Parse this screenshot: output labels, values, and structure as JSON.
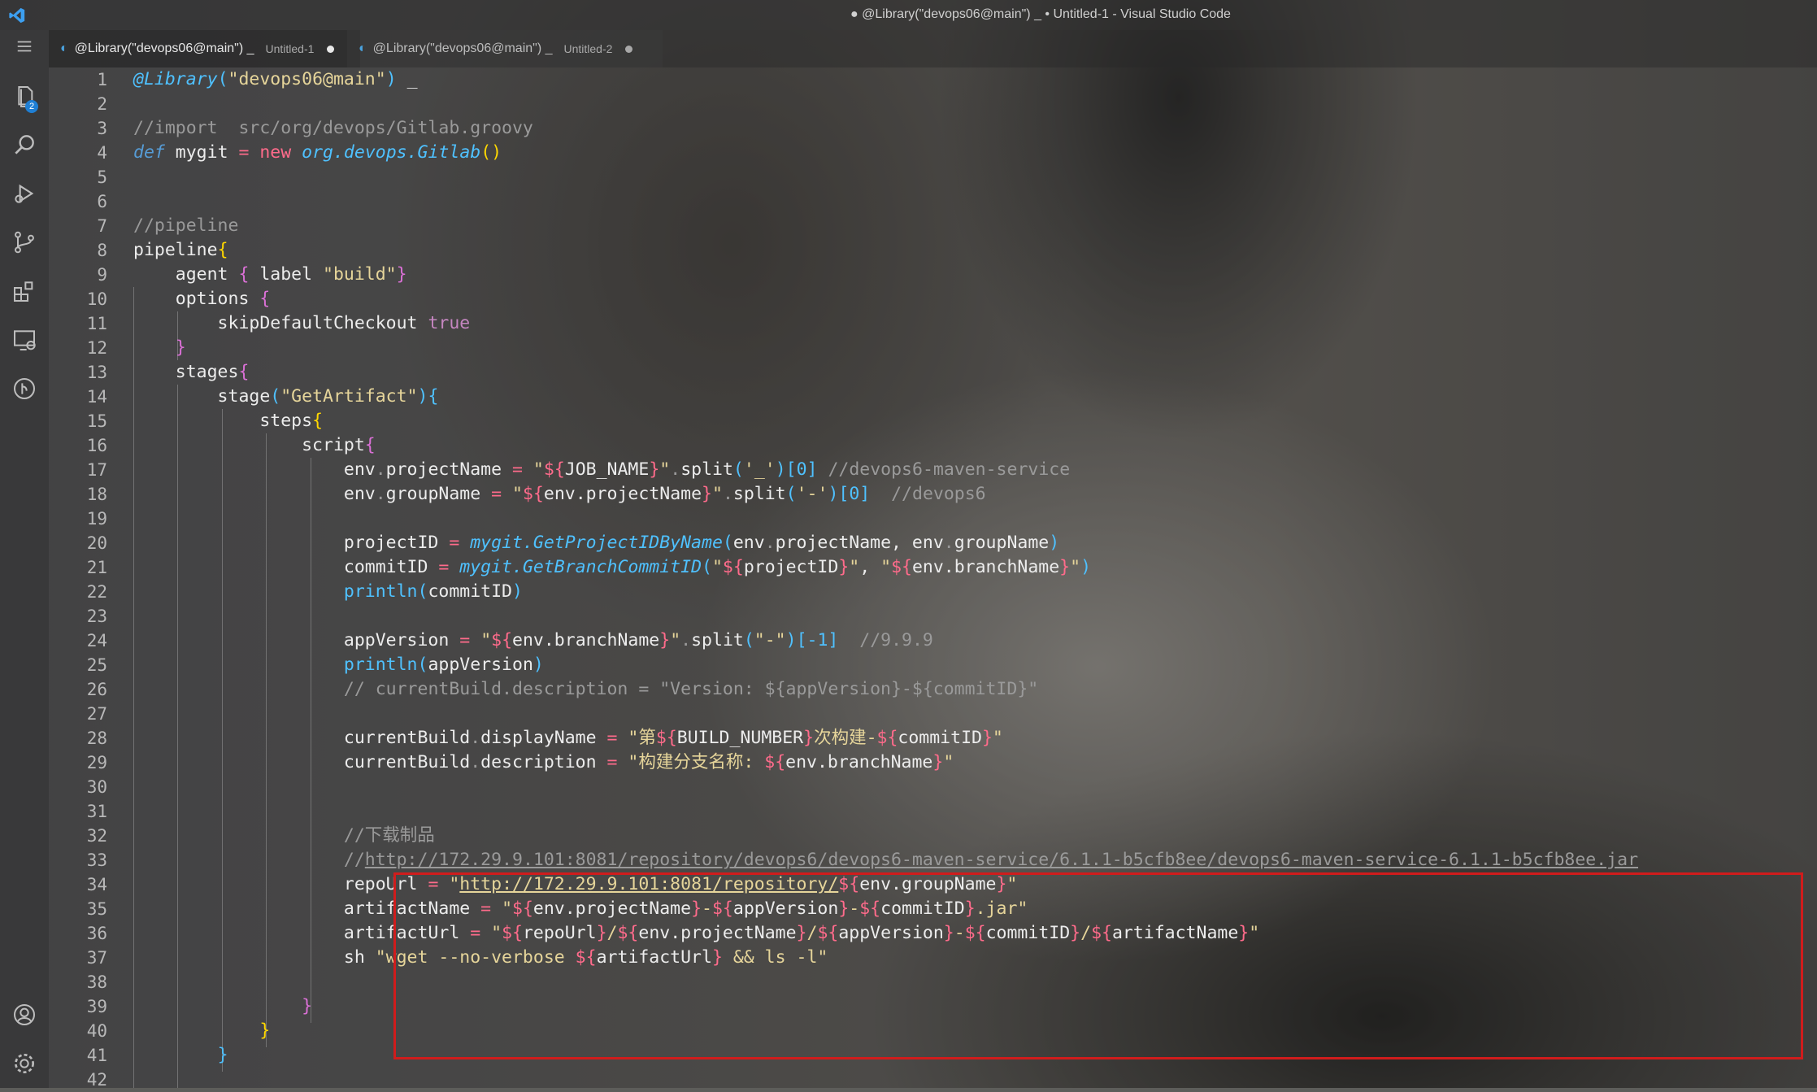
{
  "window": {
    "title": "● @Library(\"devops06@main\") _ • Untitled-1 - Visual Studio Code"
  },
  "activity_bar": {
    "explorer_badge": "2",
    "items": [
      "files-icon",
      "search-icon",
      "run-debug-icon",
      "source-control-icon",
      "extensions-icon",
      "remote-explorer-icon",
      "gitlens-icon"
    ],
    "bottom": [
      "account-icon",
      "settings-gear-icon"
    ]
  },
  "tabs": [
    {
      "label": "@Library(\"devops06@main\") _",
      "sub": "Untitled-1",
      "active": true,
      "modified": true
    },
    {
      "label": "@Library(\"devops06@main\") _",
      "sub": "Untitled-2",
      "active": false,
      "modified": true
    }
  ],
  "editor": {
    "line_numbers": [
      "1",
      "2",
      "3",
      "4",
      "5",
      "6",
      "7",
      "8",
      "9",
      "10",
      "11",
      "12",
      "13",
      "14",
      "15",
      "16",
      "17",
      "18",
      "19",
      "20",
      "21",
      "22",
      "23",
      "24",
      "25",
      "26",
      "27",
      "28",
      "29",
      "30",
      "31",
      "32",
      "33",
      "34",
      "35",
      "36",
      "37",
      "38",
      "39",
      "40",
      "41",
      "42"
    ],
    "lines": [
      [
        [
          "dec",
          "@Library"
        ],
        [
          "pun2",
          "("
        ],
        [
          "str",
          "\"devops06@main\""
        ],
        [
          "pun2",
          ")"
        ],
        [
          "plain",
          " _"
        ]
      ],
      [],
      [
        [
          "cmt",
          "//import  src/org/devops/Gitlab.groovy"
        ]
      ],
      [
        [
          "kw",
          "def"
        ],
        [
          "plain",
          " mygit "
        ],
        [
          "new",
          "="
        ],
        [
          "plain",
          " "
        ],
        [
          "new",
          "new"
        ],
        [
          "plain",
          " "
        ],
        [
          "fn",
          "org.devops.Gitlab"
        ],
        [
          "yel",
          "()"
        ]
      ],
      [],
      [],
      [
        [
          "cmt",
          "//pipeline"
        ]
      ],
      [
        [
          "plain",
          "pipeline"
        ],
        [
          "yel",
          "{"
        ]
      ],
      [
        [
          "plain",
          "    agent "
        ],
        [
          "pun",
          "{"
        ],
        [
          "plain",
          " label "
        ],
        [
          "str",
          "\"build\""
        ],
        [
          "pun",
          "}"
        ]
      ],
      [
        [
          "plain",
          "    options "
        ],
        [
          "pun",
          "{"
        ]
      ],
      [
        [
          "plain",
          "        skipDefaultCheckout "
        ],
        [
          "bool",
          "true"
        ]
      ],
      [
        [
          "plain",
          "    "
        ],
        [
          "pun",
          "}"
        ]
      ],
      [
        [
          "plain",
          "    stages"
        ],
        [
          "pun",
          "{"
        ]
      ],
      [
        [
          "plain",
          "        stage"
        ],
        [
          "pun2",
          "("
        ],
        [
          "str",
          "\"GetArtifact\""
        ],
        [
          "pun2",
          ")"
        ],
        [
          "pun2",
          "{"
        ]
      ],
      [
        [
          "plain",
          "            steps"
        ],
        [
          "yel",
          "{"
        ]
      ],
      [
        [
          "plain",
          "                script"
        ],
        [
          "pun",
          "{"
        ]
      ],
      [
        [
          "plain",
          "                    env"
        ],
        [
          "cmt",
          "."
        ],
        [
          "plain",
          "projectName "
        ],
        [
          "new",
          "="
        ],
        [
          "plain",
          " "
        ],
        [
          "str",
          "\""
        ],
        [
          "tpl",
          "${"
        ],
        [
          "plain",
          "JOB_NAME"
        ],
        [
          "tpl",
          "}"
        ],
        [
          "str",
          "\""
        ],
        [
          "cmt",
          "."
        ],
        [
          "plain",
          "split"
        ],
        [
          "pun2",
          "("
        ],
        [
          "str",
          "'_'"
        ],
        [
          "pun2",
          ")[0]"
        ],
        [
          "plain",
          " "
        ],
        [
          "cmt",
          "//devops6-maven-service"
        ]
      ],
      [
        [
          "plain",
          "                    env"
        ],
        [
          "cmt",
          "."
        ],
        [
          "plain",
          "groupName "
        ],
        [
          "new",
          "="
        ],
        [
          "plain",
          " "
        ],
        [
          "str",
          "\""
        ],
        [
          "tpl",
          "${"
        ],
        [
          "plain",
          "env.projectName"
        ],
        [
          "tpl",
          "}"
        ],
        [
          "str",
          "\""
        ],
        [
          "cmt",
          "."
        ],
        [
          "plain",
          "split"
        ],
        [
          "pun2",
          "("
        ],
        [
          "str",
          "'-'"
        ],
        [
          "pun2",
          ")[0]"
        ],
        [
          "plain",
          "  "
        ],
        [
          "cmt",
          "//devops6"
        ]
      ],
      [],
      [
        [
          "plain",
          "                    projectID "
        ],
        [
          "new",
          "="
        ],
        [
          "plain",
          " "
        ],
        [
          "fn",
          "mygit.GetProjectIDByName"
        ],
        [
          "pun2",
          "("
        ],
        [
          "plain",
          "env"
        ],
        [
          "cmt",
          "."
        ],
        [
          "plain",
          "projectName, env"
        ],
        [
          "cmt",
          "."
        ],
        [
          "plain",
          "groupName"
        ],
        [
          "pun2",
          ")"
        ]
      ],
      [
        [
          "plain",
          "                    commitID "
        ],
        [
          "new",
          "="
        ],
        [
          "plain",
          " "
        ],
        [
          "fn",
          "mygit.GetBranchCommitID"
        ],
        [
          "pun2",
          "("
        ],
        [
          "str",
          "\""
        ],
        [
          "tpl",
          "${"
        ],
        [
          "plain",
          "projectID"
        ],
        [
          "tpl",
          "}"
        ],
        [
          "str",
          "\""
        ],
        [
          "plain",
          ", "
        ],
        [
          "str",
          "\""
        ],
        [
          "tpl",
          "${"
        ],
        [
          "plain",
          "env.branchName"
        ],
        [
          "tpl",
          "}"
        ],
        [
          "str",
          "\""
        ],
        [
          "pun2",
          ")"
        ]
      ],
      [
        [
          "plain",
          "                    "
        ],
        [
          "pun2",
          "println"
        ],
        [
          "pun2",
          "("
        ],
        [
          "plain",
          "commitID"
        ],
        [
          "pun2",
          ")"
        ]
      ],
      [],
      [
        [
          "plain",
          "                    appVersion "
        ],
        [
          "new",
          "="
        ],
        [
          "plain",
          " "
        ],
        [
          "str",
          "\""
        ],
        [
          "tpl",
          "${"
        ],
        [
          "plain",
          "env.branchName"
        ],
        [
          "tpl",
          "}"
        ],
        [
          "str",
          "\""
        ],
        [
          "cmt",
          "."
        ],
        [
          "plain",
          "split"
        ],
        [
          "pun2",
          "("
        ],
        [
          "str",
          "\"-\""
        ],
        [
          "pun2",
          ")[-1]"
        ],
        [
          "plain",
          "  "
        ],
        [
          "cmt",
          "//9.9.9"
        ]
      ],
      [
        [
          "plain",
          "                    "
        ],
        [
          "pun2",
          "println"
        ],
        [
          "pun2",
          "("
        ],
        [
          "plain",
          "appVersion"
        ],
        [
          "pun2",
          ")"
        ]
      ],
      [
        [
          "plain",
          "                    "
        ],
        [
          "cmt",
          "// currentBuild.description = \"Version: ${appVersion}-${commitID}\""
        ]
      ],
      [],
      [
        [
          "plain",
          "                    currentBuild"
        ],
        [
          "cmt",
          "."
        ],
        [
          "plain",
          "displayName "
        ],
        [
          "new",
          "="
        ],
        [
          "plain",
          " "
        ],
        [
          "str",
          "\"第"
        ],
        [
          "tpl",
          "${"
        ],
        [
          "plain",
          "BUILD_NUMBER"
        ],
        [
          "tpl",
          "}"
        ],
        [
          "str",
          "次构建-"
        ],
        [
          "tpl",
          "${"
        ],
        [
          "plain",
          "commitID"
        ],
        [
          "tpl",
          "}"
        ],
        [
          "str",
          "\""
        ]
      ],
      [
        [
          "plain",
          "                    currentBuild"
        ],
        [
          "cmt",
          "."
        ],
        [
          "plain",
          "description "
        ],
        [
          "new",
          "="
        ],
        [
          "plain",
          " "
        ],
        [
          "str",
          "\"构建分支名称: "
        ],
        [
          "tpl",
          "${"
        ],
        [
          "plain",
          "env.branchName"
        ],
        [
          "tpl",
          "}"
        ],
        [
          "str",
          "\""
        ]
      ],
      [],
      [],
      [
        [
          "plain",
          "                    "
        ],
        [
          "cmt",
          "//下载制品"
        ]
      ],
      [
        [
          "plain",
          "                    "
        ],
        [
          "cmt",
          "//"
        ],
        [
          "curl",
          "http://172.29.9.101:8081/repository/devops6/devops6-maven-service/6.1.1-b5cfb8ee/devops6-maven-service-6.1.1-b5cfb8ee.jar"
        ]
      ],
      [
        [
          "plain",
          "                    repoUrl "
        ],
        [
          "new",
          "="
        ],
        [
          "plain",
          " "
        ],
        [
          "str",
          "\""
        ],
        [
          "url",
          "http://172.29.9.101:8081/repository/"
        ],
        [
          "tpl",
          "${"
        ],
        [
          "plain",
          "env.groupName"
        ],
        [
          "tpl",
          "}"
        ],
        [
          "str",
          "\""
        ]
      ],
      [
        [
          "plain",
          "                    artifactName "
        ],
        [
          "new",
          "="
        ],
        [
          "plain",
          " "
        ],
        [
          "str",
          "\""
        ],
        [
          "tpl",
          "${"
        ],
        [
          "plain",
          "env.projectName"
        ],
        [
          "tpl",
          "}"
        ],
        [
          "str",
          "-"
        ],
        [
          "tpl",
          "${"
        ],
        [
          "plain",
          "appVersion"
        ],
        [
          "tpl",
          "}"
        ],
        [
          "str",
          "-"
        ],
        [
          "tpl",
          "${"
        ],
        [
          "plain",
          "commitID"
        ],
        [
          "tpl",
          "}"
        ],
        [
          "str",
          ".jar\""
        ]
      ],
      [
        [
          "plain",
          "                    artifactUrl "
        ],
        [
          "new",
          "="
        ],
        [
          "plain",
          " "
        ],
        [
          "str",
          "\""
        ],
        [
          "tpl",
          "${"
        ],
        [
          "plain",
          "repoUrl"
        ],
        [
          "tpl",
          "}"
        ],
        [
          "str",
          "/"
        ],
        [
          "tpl",
          "${"
        ],
        [
          "plain",
          "env.projectName"
        ],
        [
          "tpl",
          "}"
        ],
        [
          "str",
          "/"
        ],
        [
          "tpl",
          "${"
        ],
        [
          "plain",
          "appVersion"
        ],
        [
          "tpl",
          "}"
        ],
        [
          "str",
          "-"
        ],
        [
          "tpl",
          "${"
        ],
        [
          "plain",
          "commitID"
        ],
        [
          "tpl",
          "}"
        ],
        [
          "str",
          "/"
        ],
        [
          "tpl",
          "${"
        ],
        [
          "plain",
          "artifactName"
        ],
        [
          "tpl",
          "}"
        ],
        [
          "str",
          "\""
        ]
      ],
      [
        [
          "plain",
          "                    sh "
        ],
        [
          "str",
          "\"wget --no-verbose "
        ],
        [
          "tpl",
          "${"
        ],
        [
          "plain",
          "artifactUrl"
        ],
        [
          "tpl",
          "}"
        ],
        [
          "str",
          " && ls -l\""
        ]
      ],
      [],
      [
        [
          "plain",
          "                "
        ],
        [
          "pun",
          "}"
        ]
      ],
      [
        [
          "plain",
          "            "
        ],
        [
          "yel",
          "}"
        ]
      ],
      [
        [
          "plain",
          "        "
        ],
        [
          "pun2",
          "}"
        ]
      ],
      []
    ]
  }
}
